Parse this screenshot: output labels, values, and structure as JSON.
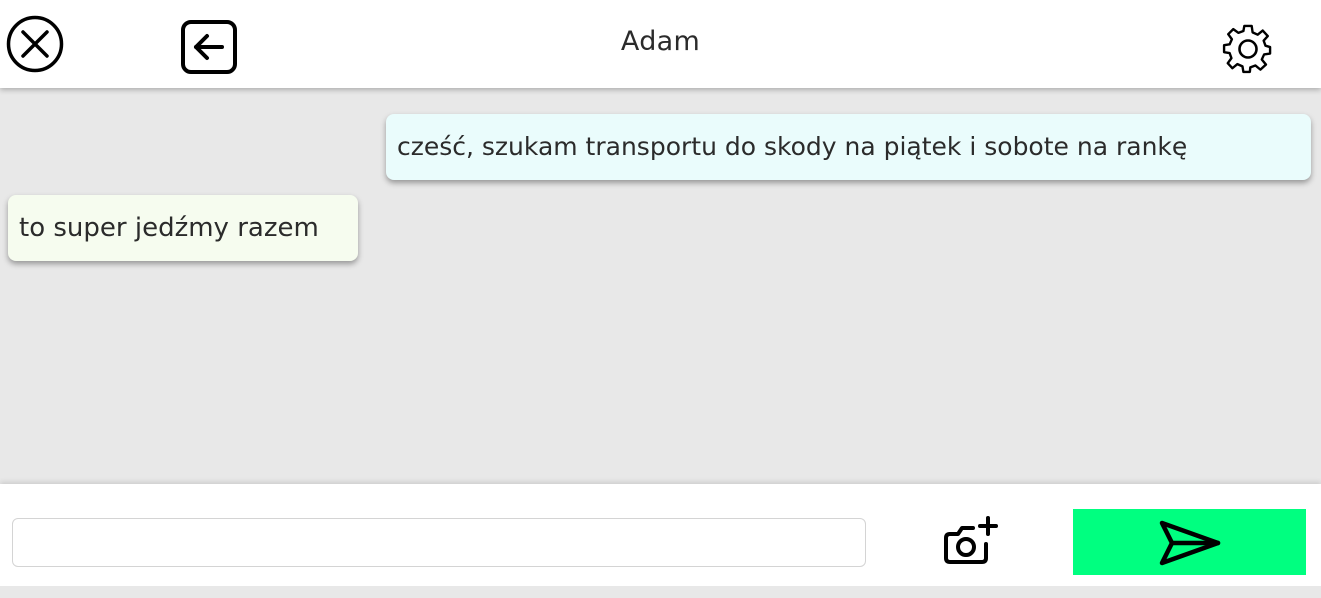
{
  "header": {
    "title": "Adam",
    "close_icon": "close-circle-icon",
    "back_icon": "back-arrow-icon",
    "settings_icon": "gear-icon"
  },
  "messages": [
    {
      "direction": "sent",
      "text": "cześć, szukam transportu do skody na piątek i sobote na rankę"
    },
    {
      "direction": "received",
      "text": "to super jedźmy razem"
    }
  ],
  "composer": {
    "input_value": "",
    "input_placeholder": "",
    "camera_icon": "add-photo-camera-icon",
    "send_icon": "send-arrow-icon"
  },
  "colors": {
    "header_bg": "#ffffff",
    "chat_bg": "#e8e8e8",
    "sent_bubble": "#eafcfc",
    "received_bubble": "#f6fcef",
    "send_button": "#00ff80",
    "text": "#2b2b2b"
  }
}
